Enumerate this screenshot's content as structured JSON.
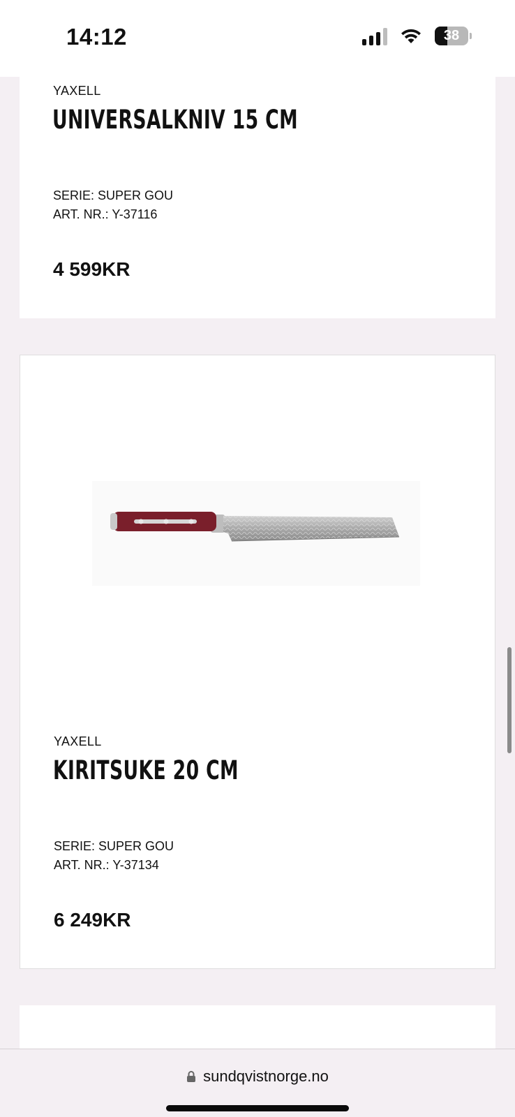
{
  "status_bar": {
    "time": "14:12",
    "battery": "38"
  },
  "products": [
    {
      "brand": "YAXELL",
      "name": "UNIVERSALKNIV 15 CM",
      "serie": "SERIE: SUPER GOU",
      "art_nr": "ART. NR.: Y-37116",
      "price": "4 599KR"
    },
    {
      "brand": "YAXELL",
      "name": "KIRITSUKE 20 CM",
      "serie": "SERIE: SUPER GOU",
      "art_nr": "ART. NR.: Y-37134",
      "price": "6 249KR",
      "image_icon": "kiritsuke-knife-image"
    }
  ],
  "browser": {
    "url": "sundqvistnorge.no",
    "lock_icon": "lock-icon"
  },
  "colors": {
    "page_bg": "#f4eff3",
    "card_bg": "#ffffff",
    "handle": "#7a1f2b"
  }
}
